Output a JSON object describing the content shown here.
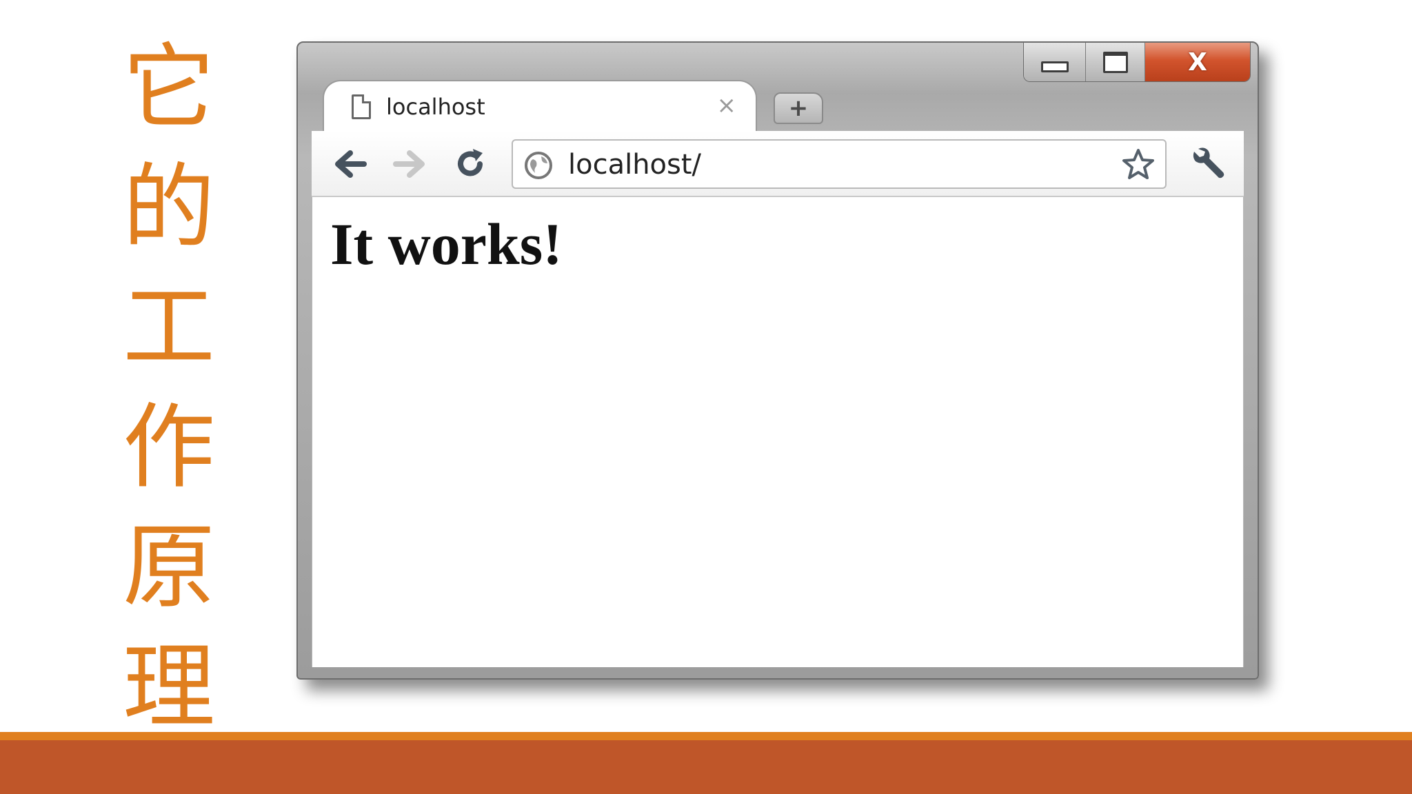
{
  "slide": {
    "title_chars": [
      "它",
      "的",
      "工",
      "作",
      "原",
      "理"
    ],
    "accent_color": "#e07f1f",
    "footer_color": "#bf5629"
  },
  "browser": {
    "tab": {
      "label": "localhost",
      "close_glyph": "×",
      "icon": "page-icon"
    },
    "new_tab_glyph": "+",
    "window_controls": {
      "close_glyph": "X"
    },
    "address_bar": {
      "value": "localhost/",
      "icon": "globe-icon"
    },
    "toolbar_icons": [
      "back-arrow-icon",
      "forward-arrow-icon",
      "reload-icon",
      "star-icon",
      "wrench-icon"
    ],
    "content": {
      "heading": "It works!"
    }
  }
}
